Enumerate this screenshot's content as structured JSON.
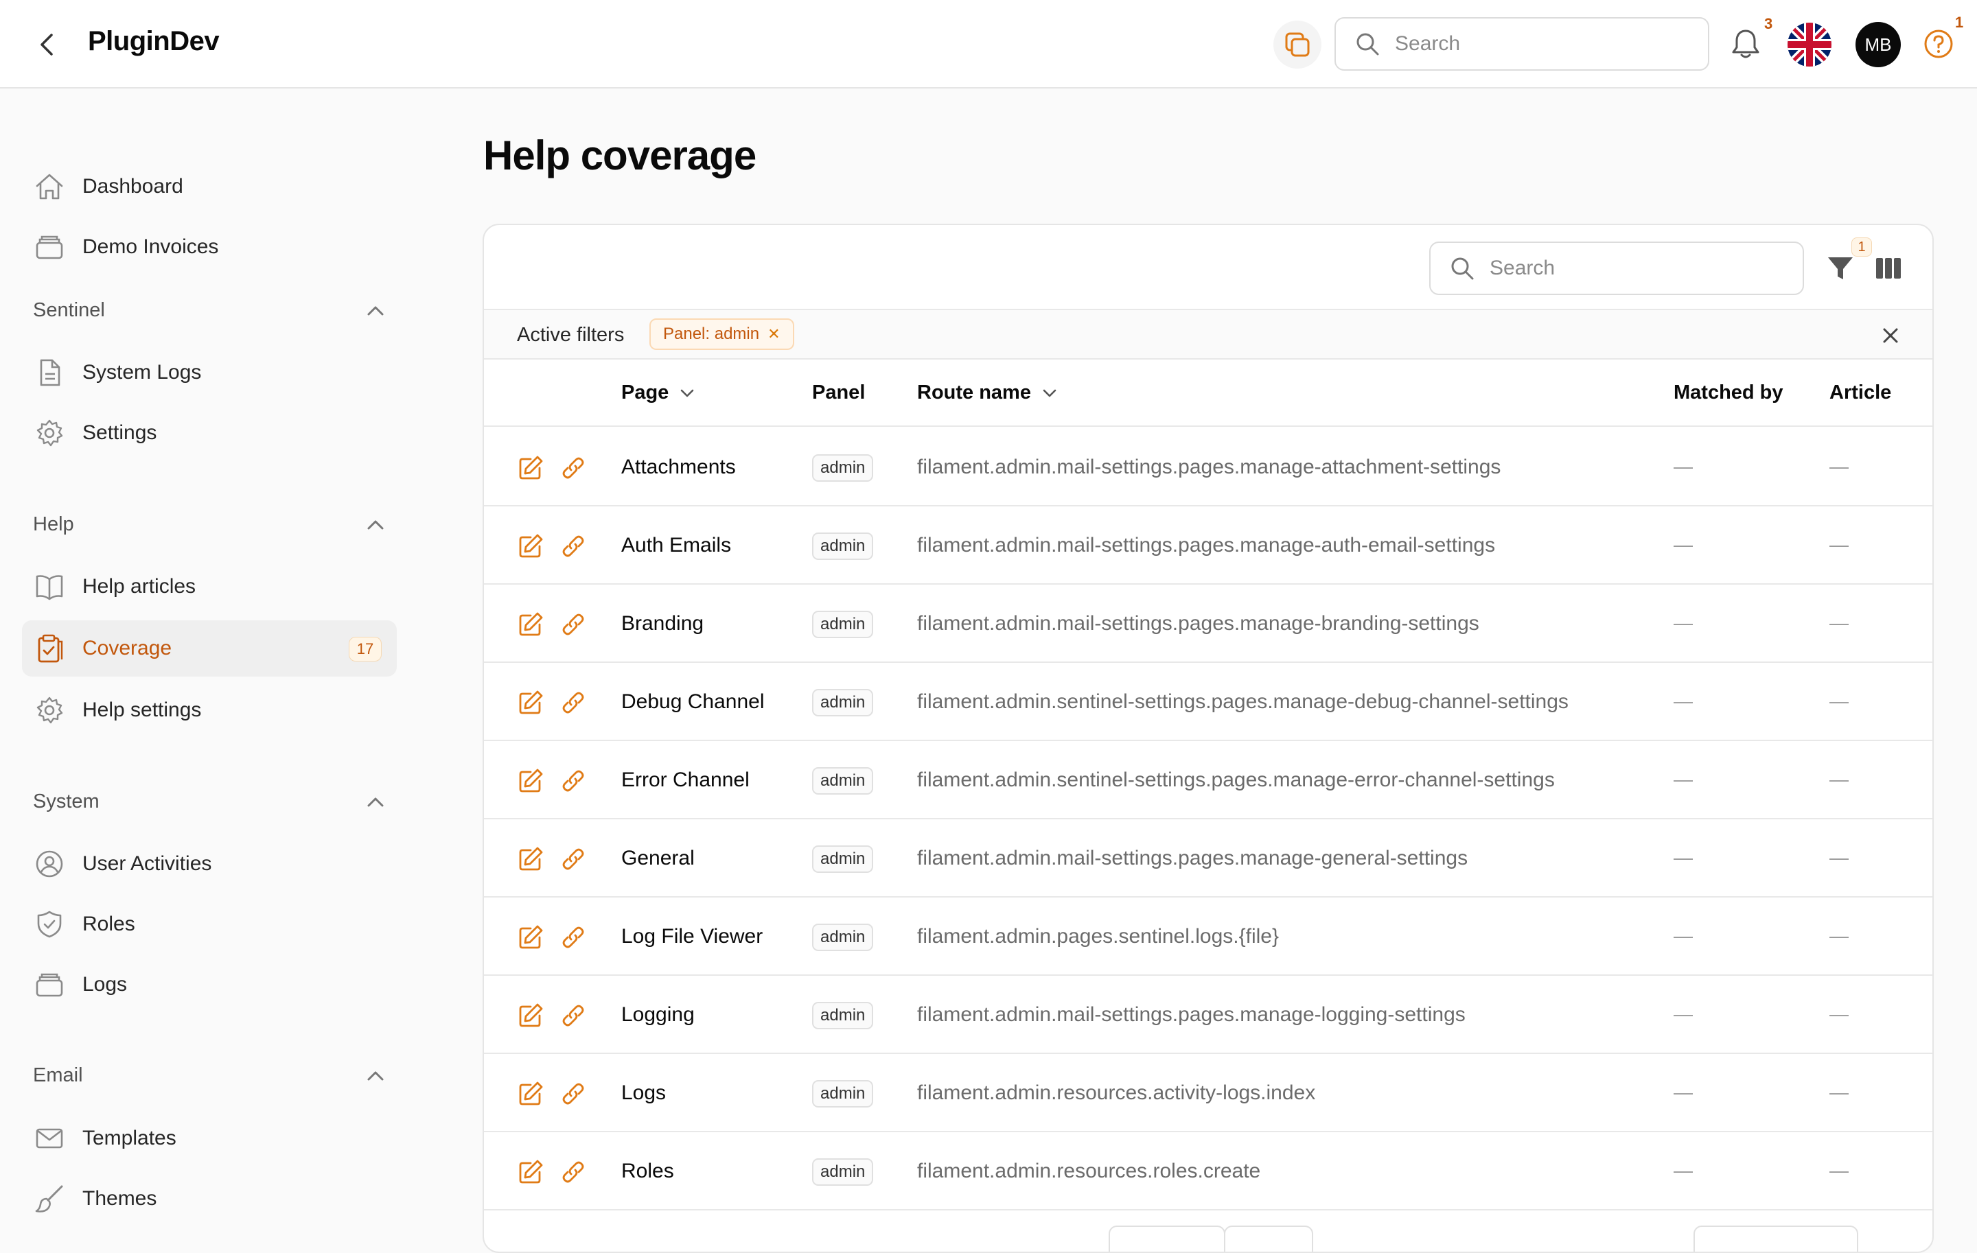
{
  "app": {
    "title": "PluginDev"
  },
  "header": {
    "search_placeholder": "Search",
    "notifications_count": "3",
    "user_initials": "MB",
    "help_count": "1"
  },
  "sidebar": {
    "top_items": [
      {
        "label": "Dashboard",
        "icon": "home-icon"
      },
      {
        "label": "Demo Invoices",
        "icon": "inbox-stack-icon"
      }
    ],
    "groups": [
      {
        "label": "Sentinel",
        "items": [
          {
            "label": "System Logs",
            "icon": "document-icon"
          },
          {
            "label": "Settings",
            "icon": "gear-icon"
          }
        ]
      },
      {
        "label": "Help",
        "items": [
          {
            "label": "Help articles",
            "icon": "book-icon"
          },
          {
            "label": "Coverage",
            "icon": "clipboard-check-icon",
            "badge": "17",
            "active": true
          },
          {
            "label": "Help settings",
            "icon": "gear-icon"
          }
        ]
      },
      {
        "label": "System",
        "items": [
          {
            "label": "User Activities",
            "icon": "user-circle-icon"
          },
          {
            "label": "Roles",
            "icon": "shield-icon"
          },
          {
            "label": "Logs",
            "icon": "inbox-stack-icon"
          }
        ]
      },
      {
        "label": "Email",
        "items": [
          {
            "label": "Templates",
            "icon": "envelope-icon"
          },
          {
            "label": "Themes",
            "icon": "paint-brush-icon"
          }
        ]
      }
    ]
  },
  "main": {
    "title": "Help coverage",
    "table_search_placeholder": "Search",
    "filter_count": "1",
    "active_filters_label": "Active filters",
    "active_filter_chip": "Panel: admin",
    "columns": {
      "page": "Page",
      "panel": "Panel",
      "route": "Route name",
      "matched": "Matched by",
      "article": "Article"
    },
    "rows": [
      {
        "page": "Attachments",
        "panel": "admin",
        "route": "filament.admin.mail-settings.pages.manage-attachment-settings",
        "matched": "—",
        "article": "—"
      },
      {
        "page": "Auth Emails",
        "panel": "admin",
        "route": "filament.admin.mail-settings.pages.manage-auth-email-settings",
        "matched": "—",
        "article": "—"
      },
      {
        "page": "Branding",
        "panel": "admin",
        "route": "filament.admin.mail-settings.pages.manage-branding-settings",
        "matched": "—",
        "article": "—"
      },
      {
        "page": "Debug Channel",
        "panel": "admin",
        "route": "filament.admin.sentinel-settings.pages.manage-debug-channel-settings",
        "matched": "—",
        "article": "—"
      },
      {
        "page": "Error Channel",
        "panel": "admin",
        "route": "filament.admin.sentinel-settings.pages.manage-error-channel-settings",
        "matched": "—",
        "article": "—"
      },
      {
        "page": "General",
        "panel": "admin",
        "route": "filament.admin.mail-settings.pages.manage-general-settings",
        "matched": "—",
        "article": "—"
      },
      {
        "page": "Log File Viewer",
        "panel": "admin",
        "route": "filament.admin.pages.sentinel.logs.{file}",
        "matched": "—",
        "article": "—"
      },
      {
        "page": "Logging",
        "panel": "admin",
        "route": "filament.admin.mail-settings.pages.manage-logging-settings",
        "matched": "—",
        "article": "—"
      },
      {
        "page": "Logs",
        "panel": "admin",
        "route": "filament.admin.resources.activity-logs.index",
        "matched": "—",
        "article": "—"
      },
      {
        "page": "Roles",
        "panel": "admin",
        "route": "filament.admin.resources.roles.create",
        "matched": "—",
        "article": "—"
      }
    ]
  },
  "colors": {
    "accent": "#c2570c",
    "icon_accent": "#e07b16",
    "sidebar_icon": "#8a8a8a"
  }
}
